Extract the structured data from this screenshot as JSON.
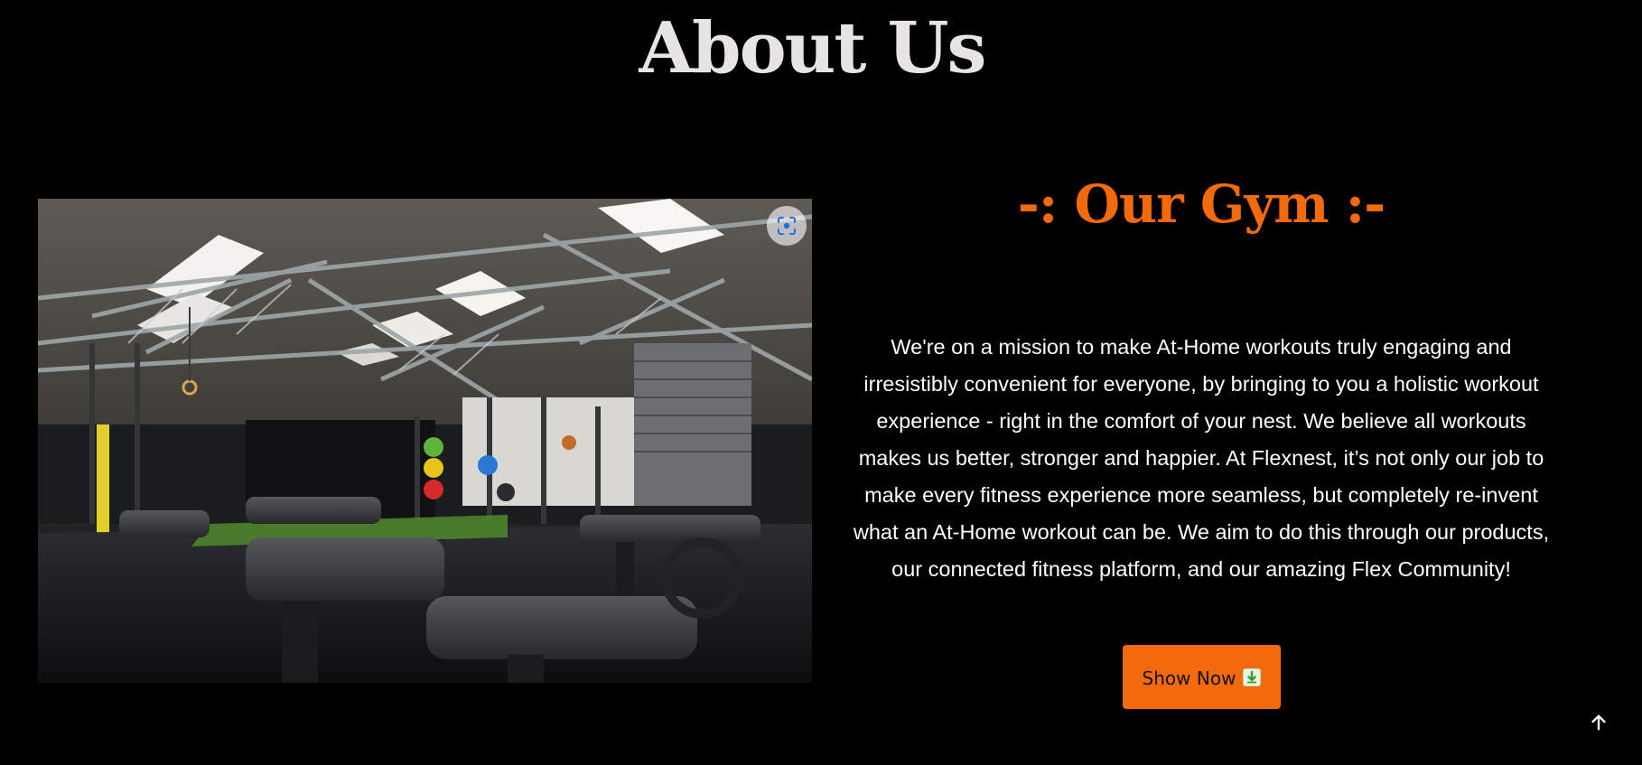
{
  "section": {
    "title": "About Us"
  },
  "photo": {
    "description_icon": "lens-icon"
  },
  "content": {
    "subtitle": "-: Our Gym :-",
    "paragraph": "We're on a mission to make At-Home workouts truly engaging and irresistibly convenient for everyone, by bringing to you a holistic workout experience - right in the comfort of your nest. We believe all workouts makes us better, stronger and happier. At Flexnest, it’s not only our job to make every fitness experience more seamless, but completely re-invent what an At-Home workout can be. We aim to do this through our products, our connected fitness platform, and our amazing Flex Community!",
    "button_label": "Show Now",
    "button_icon": "download-icon"
  },
  "colors": {
    "accent": "#f26a0b",
    "background": "#000000",
    "heading": "#e6e4e4",
    "text": "#ffffff"
  },
  "back_to_top_icon": "arrow-up-icon"
}
